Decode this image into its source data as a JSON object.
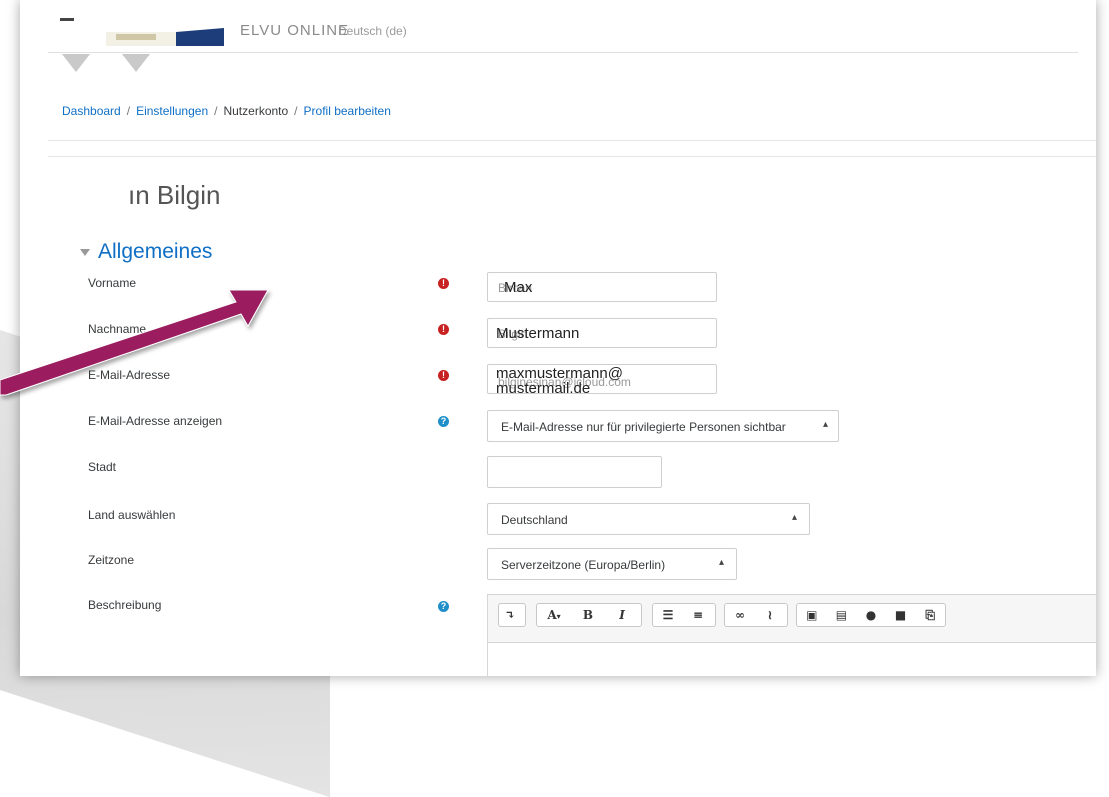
{
  "site": {
    "name": "ELVU ONLINE",
    "language": "Deutsch (de)"
  },
  "breadcrumb": {
    "items": [
      "Dashboard",
      "Einstellungen",
      "Nutzerkonto",
      "Profil bearbeiten"
    ],
    "separator": "/"
  },
  "page_title": "ın Bilgin",
  "section": {
    "title": "Allgemeines"
  },
  "form": {
    "vorname": {
      "label": "Vorname",
      "old_value": "Bircan",
      "new_value": "Max"
    },
    "nachname": {
      "label": "Nachname",
      "old_value": "Bilgin",
      "new_value": "Mustermann"
    },
    "email": {
      "label": "E-Mail-Adresse",
      "old_value": "bilginesinan@icloud.com",
      "new_value": "maxmustermann@\nmustermail.de"
    },
    "email_display": {
      "label": "E-Mail-Adresse anzeigen",
      "selected": "E-Mail-Adresse nur für privilegierte Personen sichtbar"
    },
    "stadt": {
      "label": "Stadt",
      "value": ""
    },
    "land": {
      "label": "Land auswählen",
      "selected": "Deutschland"
    },
    "zeitzone": {
      "label": "Zeitzone",
      "selected": "Serverzeitzone (Europa/Berlin)"
    },
    "beschreibung": {
      "label": "Beschreibung"
    }
  },
  "editor_toolbar": {
    "buttons": [
      "collapse",
      "font-color",
      "bold",
      "italic",
      "unordered-list",
      "ordered-list",
      "link",
      "unlink",
      "image",
      "media",
      "record-audio",
      "record-video",
      "manage-files"
    ],
    "glyphs": {
      "bold": "B",
      "italic": "I",
      "font": "A"
    }
  },
  "colors": {
    "link": "#0f6fc5",
    "required": "#c82121",
    "help": "#1e8fc9",
    "arrow": "#9b1a5f"
  }
}
